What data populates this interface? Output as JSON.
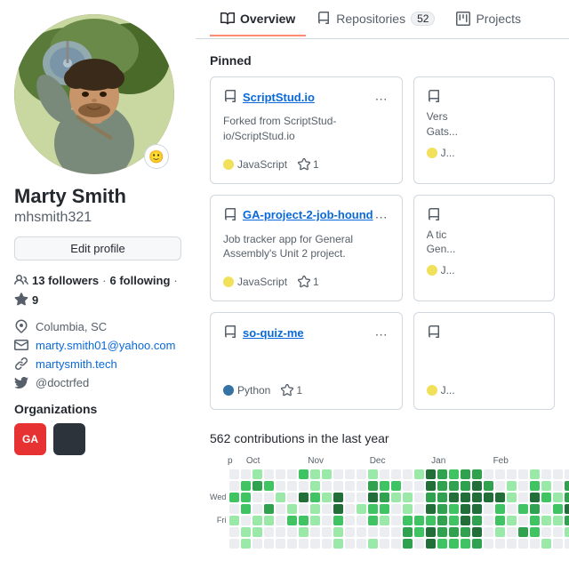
{
  "nav": {
    "tabs": [
      {
        "id": "overview",
        "label": "Overview",
        "icon": "book",
        "active": true,
        "count": null
      },
      {
        "id": "repositories",
        "label": "Repositories",
        "icon": "repo",
        "active": false,
        "count": "52"
      },
      {
        "id": "projects",
        "label": "Projects",
        "icon": "project",
        "active": false,
        "count": null
      }
    ]
  },
  "user": {
    "name": "Marty Smith",
    "login": "mhsmith321",
    "followers": 13,
    "following": 6,
    "stars": 9,
    "location": "Columbia, SC",
    "email": "marty.smith01@yahoo.com",
    "website": "martysmith.tech",
    "twitter": "@doctrfed",
    "edit_profile_label": "Edit profile"
  },
  "pinned": {
    "title": "Pinned",
    "cards": [
      {
        "name": "ScriptStud.io",
        "desc": "Forked from ScriptStud-io/ScriptStud.io",
        "lang": "JavaScript",
        "lang_type": "js",
        "stars": 1
      },
      {
        "name": "GA-project-2-job-hound",
        "desc": "Job tracker app for General Assembly's Unit 2 project.",
        "lang": "JavaScript",
        "lang_type": "js",
        "stars": 1
      },
      {
        "name": "so-quiz-me",
        "desc": "",
        "lang": "Python",
        "lang_type": "py",
        "stars": 1
      }
    ]
  },
  "contributions": {
    "title": "562 contributions in the last year",
    "months": [
      "p",
      "Oct",
      "Nov",
      "Dec",
      "Jan",
      "Feb"
    ]
  },
  "orgs": {
    "title": "Organizations",
    "items": [
      {
        "id": "ga",
        "label": "GA",
        "color": "#e63232"
      },
      {
        "id": "dark",
        "label": "",
        "color": "#2d333b"
      }
    ]
  }
}
